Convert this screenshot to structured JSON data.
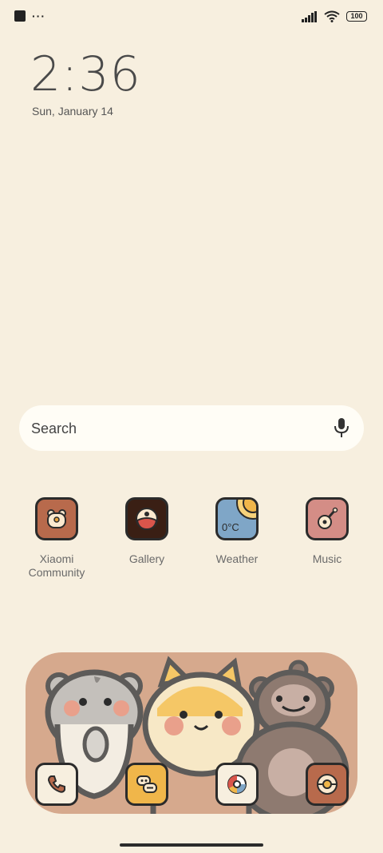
{
  "status_bar": {
    "battery": "100",
    "icons": [
      "square-notification-icon",
      "more-dots-icon",
      "signal-icon",
      "wifi-icon",
      "battery-icon"
    ]
  },
  "clock": {
    "time": "2:36",
    "date": "Sun, January 14"
  },
  "search": {
    "label": "Search",
    "icon": "mic-icon"
  },
  "apps": [
    {
      "label": "Xiaomi\nCommunity",
      "icon": "xiaomi-community-icon",
      "bg": "#b86a4c"
    },
    {
      "label": "Gallery",
      "icon": "gallery-icon",
      "bg": "#3a1f14"
    },
    {
      "label": "Weather",
      "icon": "weather-icon",
      "bg": "#7fa6c7",
      "icon_text": "0°C"
    },
    {
      "label": "Music",
      "icon": "music-icon",
      "bg": "#d48d86"
    }
  ],
  "dock": [
    {
      "name": "phone",
      "icon": "phone-icon",
      "bg": "#f7efdf"
    },
    {
      "name": "messages",
      "icon": "messages-icon",
      "bg": "#f0b64a"
    },
    {
      "name": "browser",
      "icon": "browser-icon",
      "bg": "#f7efdf"
    },
    {
      "name": "camera",
      "icon": "camera-icon",
      "bg": "#b86a4c"
    }
  ],
  "colors": {
    "background": "#f7efdf",
    "widget": "#d6a98d",
    "outline": "#2b2b2b"
  }
}
